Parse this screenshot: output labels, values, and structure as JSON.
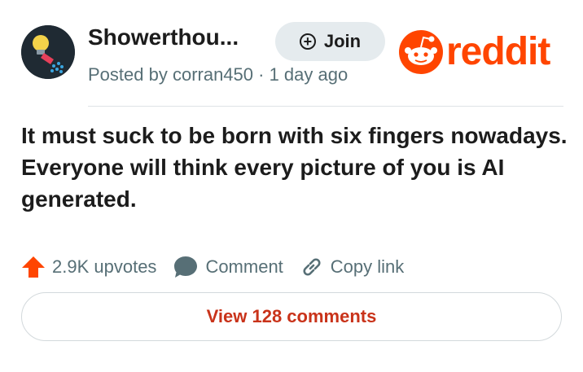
{
  "post": {
    "community": "Showerthou...",
    "posted_by": "Posted by corran450 · 1 day ago",
    "join_label": "Join",
    "title": "It must suck to be born with six fingers nowadays. Everyone will think every picture of you is AI generated."
  },
  "brand": {
    "logo_text": "reddit",
    "color": "#ff4500"
  },
  "actions": {
    "upvotes": "2.9K upvotes",
    "comment": "Comment",
    "copy_link": "Copy link"
  },
  "footer": {
    "view_comments": "View 128 comments"
  },
  "icons": {
    "avatar": "shower-head-bulb-icon",
    "join": "plus-circle-icon",
    "upvote": "upvote-arrow-icon",
    "comment": "comment-bubble-icon",
    "link": "link-icon"
  },
  "colors": {
    "upvote": "#ff4500",
    "muted_text": "#576f76",
    "link_red": "#c9331a",
    "join_bg": "#e5ebee"
  }
}
